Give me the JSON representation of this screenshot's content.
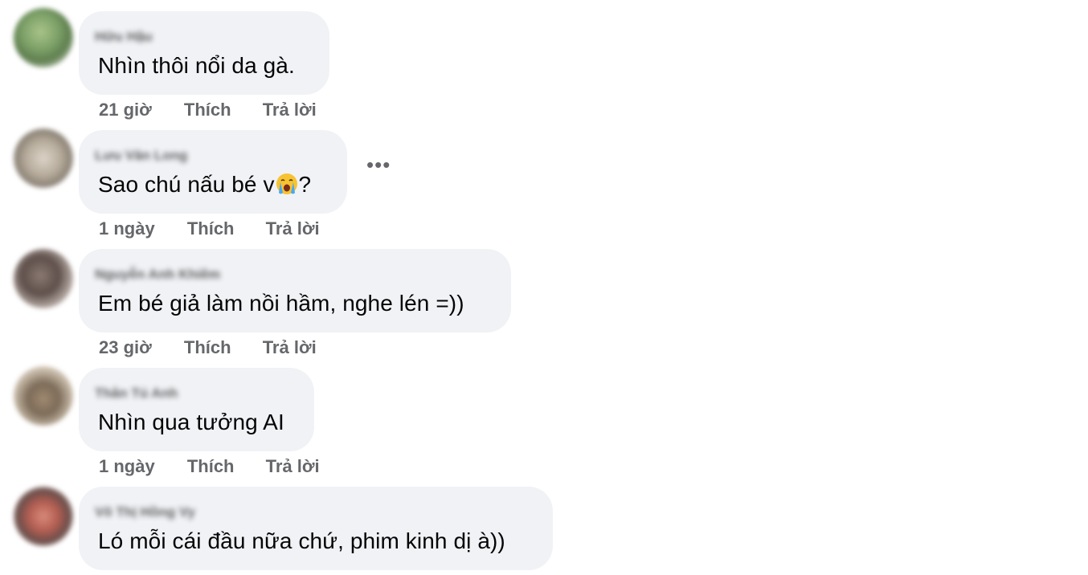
{
  "comments": [
    {
      "author": "Hữu Hậu",
      "text": "Nhìn thôi nổi da gà.",
      "time": "21 giờ",
      "like_label": "Thích",
      "reply_label": "Trả lời"
    },
    {
      "author": "Lưu Văn Long",
      "text_before": "Sao chú nấu bé v",
      "emoji": "crying-face-emoji",
      "text_after": "?",
      "time": "1 ngày",
      "like_label": "Thích",
      "reply_label": "Trả lời",
      "more_label": "•••"
    },
    {
      "author": "Nguyễn Anh Khiêm",
      "text": "Em bé giả làm nồi hầm, nghe lén =))",
      "time": "23 giờ",
      "like_label": "Thích",
      "reply_label": "Trả lời"
    },
    {
      "author": "Thân Tú Anh",
      "text": "Nhìn qua tưởng AI",
      "time": "1 ngày",
      "like_label": "Thích",
      "reply_label": "Trả lời"
    },
    {
      "author": "Võ Thị Hồng Vy",
      "text": "Ló mỗi cái đầu nữa chứ, phim kinh dị à))",
      "time": "",
      "like_label": "",
      "reply_label": ""
    }
  ],
  "colors": {
    "bubble": "#f0f2f5",
    "text": "#050505",
    "meta": "#65676b"
  }
}
